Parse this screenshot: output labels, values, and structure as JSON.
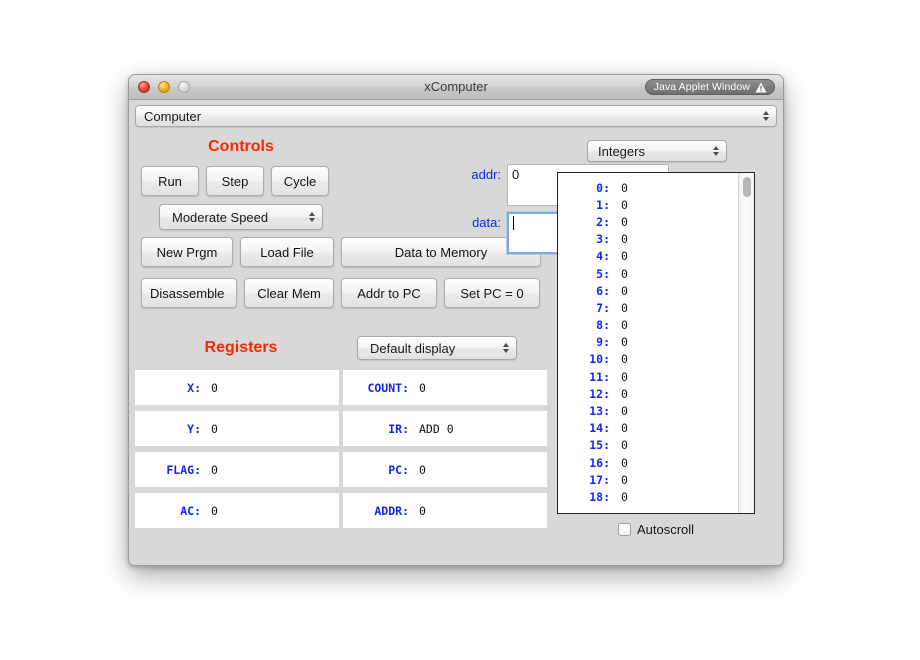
{
  "window": {
    "title": "xComputer",
    "applet_badge": "Java Applet Window",
    "traffic_lights": [
      "close-button",
      "minimize-button",
      "zoom-button"
    ]
  },
  "topbar": {
    "selected": "Computer"
  },
  "controls": {
    "heading": "Controls",
    "buttons": {
      "run": "Run",
      "step": "Step",
      "cycle": "Cycle",
      "new_prgm": "New Prgm",
      "load_file": "Load File",
      "data_to_memory": "Data to Memory",
      "disassemble": "Disassemble",
      "clear_mem": "Clear Mem",
      "addr_to_pc": "Addr to PC",
      "set_pc": "Set PC = 0"
    },
    "speed_select": "Moderate Speed",
    "fields": [
      {
        "label": "addr:",
        "value": "0",
        "focused": false
      },
      {
        "label": "data:",
        "value": "",
        "focused": true
      }
    ]
  },
  "registers": {
    "heading": "Registers",
    "display_select": "Default display",
    "items": [
      {
        "name": "X:",
        "value": "0"
      },
      {
        "name": "COUNT:",
        "value": "0"
      },
      {
        "name": "Y:",
        "value": "0"
      },
      {
        "name": "IR:",
        "value": "ADD 0"
      },
      {
        "name": "FLAG:",
        "value": "0"
      },
      {
        "name": "PC:",
        "value": "0"
      },
      {
        "name": "AC:",
        "value": "0"
      },
      {
        "name": "ADDR:",
        "value": "0"
      }
    ]
  },
  "memory": {
    "format_select": "Integers",
    "rows": [
      {
        "addr": "0:",
        "value": "0"
      },
      {
        "addr": "1:",
        "value": "0"
      },
      {
        "addr": "2:",
        "value": "0"
      },
      {
        "addr": "3:",
        "value": "0"
      },
      {
        "addr": "4:",
        "value": "0"
      },
      {
        "addr": "5:",
        "value": "0"
      },
      {
        "addr": "6:",
        "value": "0"
      },
      {
        "addr": "7:",
        "value": "0"
      },
      {
        "addr": "8:",
        "value": "0"
      },
      {
        "addr": "9:",
        "value": "0"
      },
      {
        "addr": "10:",
        "value": "0"
      },
      {
        "addr": "11:",
        "value": "0"
      },
      {
        "addr": "12:",
        "value": "0"
      },
      {
        "addr": "13:",
        "value": "0"
      },
      {
        "addr": "14:",
        "value": "0"
      },
      {
        "addr": "15:",
        "value": "0"
      },
      {
        "addr": "16:",
        "value": "0"
      },
      {
        "addr": "17:",
        "value": "0"
      },
      {
        "addr": "18:",
        "value": "0"
      }
    ],
    "autoscroll_label": "Autoscroll",
    "autoscroll_checked": false
  },
  "colors": {
    "heading_red": "#fa2800",
    "label_blue": "#1326f0",
    "window_bg": "#d8d8d8",
    "focus_ring": "#7cacdc"
  }
}
